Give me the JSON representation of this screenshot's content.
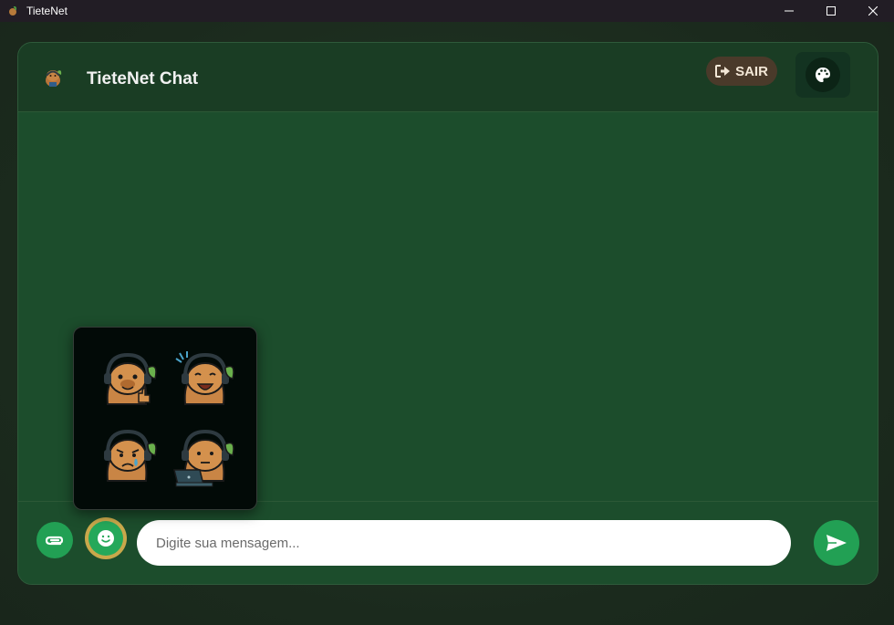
{
  "window": {
    "title": "TieteNet",
    "minimize": "—",
    "maximize": "☐",
    "close": "✕"
  },
  "header": {
    "title": "TieteNet Chat",
    "logout_label": "SAIR"
  },
  "composer": {
    "placeholder": "Digite sua mensagem..."
  },
  "stickers": [
    {
      "name": "sticker-capybara-thumbs-up"
    },
    {
      "name": "sticker-capybara-laughing"
    },
    {
      "name": "sticker-capybara-crying"
    },
    {
      "name": "sticker-capybara-laptop"
    }
  ],
  "colors": {
    "accent_green": "#22a054",
    "panel_green": "#1c4d2c",
    "header_green": "#1a3d24",
    "logout_brown": "#4a3a2a"
  }
}
